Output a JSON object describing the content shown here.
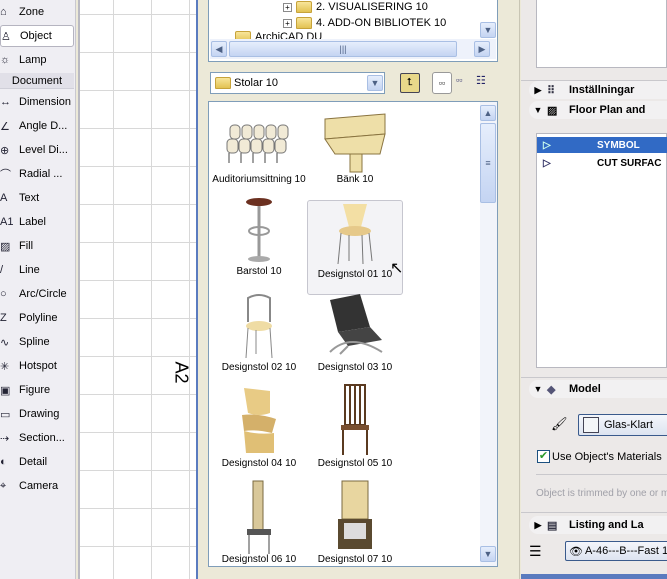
{
  "toolbox": {
    "top_items": [
      {
        "label": "Zone",
        "icon": "zone-icon"
      },
      {
        "label": "Object",
        "icon": "object-icon",
        "selected": true
      },
      {
        "label": "Lamp",
        "icon": "lamp-icon"
      }
    ],
    "section": "Document",
    "doc_items": [
      {
        "label": "Dimension",
        "icon": "dimension-icon"
      },
      {
        "label": "Angle D...",
        "icon": "angle-dimension-icon"
      },
      {
        "label": "Level Di...",
        "icon": "level-dimension-icon"
      },
      {
        "label": "Radial ...",
        "icon": "radial-dimension-icon"
      },
      {
        "label": "Text",
        "icon": "text-icon"
      },
      {
        "label": "Label",
        "icon": "label-icon"
      },
      {
        "label": "Fill",
        "icon": "fill-icon"
      },
      {
        "label": "Line",
        "icon": "line-icon"
      },
      {
        "label": "Arc/Circle",
        "icon": "arc-circle-icon"
      },
      {
        "label": "Polyline",
        "icon": "polyline-icon"
      },
      {
        "label": "Spline",
        "icon": "spline-icon"
      },
      {
        "label": "Hotspot",
        "icon": "hotspot-icon"
      },
      {
        "label": "Figure",
        "icon": "figure-icon"
      },
      {
        "label": "Drawing",
        "icon": "drawing-icon"
      },
      {
        "label": "Section...",
        "icon": "section-icon"
      },
      {
        "label": "Detail",
        "icon": "detail-icon"
      },
      {
        "label": "Camera",
        "icon": "camera-icon"
      }
    ]
  },
  "canvas": {
    "marker_text": "A2"
  },
  "library": {
    "tree": [
      "2. VISUALISERING 10",
      "4. ADD-ON BIBLIOTEK 10",
      "ArchiCAD DU"
    ],
    "folder_select": "Stolar 10",
    "items": [
      {
        "label": "Auditoriumsittning 10",
        "kind": "auditorium"
      },
      {
        "label": "Bänk 10",
        "kind": "bench"
      },
      {
        "label": "Barstol 10",
        "kind": "barstool"
      },
      {
        "label": "Designstol 01 10",
        "kind": "chair01",
        "selected": true
      },
      {
        "label": "Designstol 02 10",
        "kind": "chair02"
      },
      {
        "label": "Designstol 03 10",
        "kind": "chair03"
      },
      {
        "label": "Designstol 04 10",
        "kind": "chair04"
      },
      {
        "label": "Designstol 05 10",
        "kind": "chair05"
      },
      {
        "label": "Designstol 06 10",
        "kind": "chair06"
      },
      {
        "label": "Designstol 07 10",
        "kind": "chair07"
      }
    ]
  },
  "settings": {
    "panel_installningar": "Inställningar",
    "panel_floorplan": "Floor Plan and",
    "rows": [
      {
        "label": "SYMBOL",
        "selected": true
      },
      {
        "label": "CUT SURFAC"
      }
    ],
    "panel_model": "Model",
    "material": "Glas-Klart",
    "use_materials_label": "Use Object's Materials",
    "use_materials_checked": true,
    "trim_note": "Object is trimmed by one or m",
    "panel_listing": "Listing and La",
    "layer": "A-46---B---Fast 1",
    "colors": {
      "selection": "#316ac5",
      "accent_border": "#7f9db9"
    }
  }
}
